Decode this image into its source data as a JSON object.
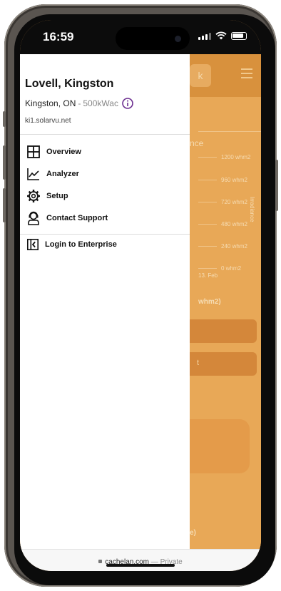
{
  "status": {
    "time": "16:59"
  },
  "drawer": {
    "site_name": "Lovell, Kingston",
    "location": "Kingston, ON",
    "separator": "-",
    "capacity": "500kWac",
    "url": "ki1.solarvu.net",
    "nav": [
      {
        "label": "Overview",
        "icon": "grid-icon"
      },
      {
        "label": "Analyzer",
        "icon": "line-chart-icon"
      },
      {
        "label": "Setup",
        "icon": "gear-icon"
      },
      {
        "label": "Contact Support",
        "icon": "support-agent-icon"
      }
    ],
    "login_label": "Login to Enterprise"
  },
  "background": {
    "header_button": "k",
    "title_fragment": "nce",
    "axis_ticks": [
      "1200 whm2",
      "960 whm2",
      "720 whm2",
      "480 whm2",
      "240 whm2",
      "0 whm2"
    ],
    "date_label": "13. Feb",
    "side_label": "Irradiance",
    "unit_fragment": "whm2)",
    "button2_fragment": "t",
    "bottom_fragment": "e)"
  },
  "browser": {
    "domain": "cachelan.com",
    "dash": "—",
    "mode": "Private"
  },
  "colors": {
    "overlay": "#e8a857",
    "header": "#d8913d",
    "info_accent": "#6b2d8f"
  }
}
